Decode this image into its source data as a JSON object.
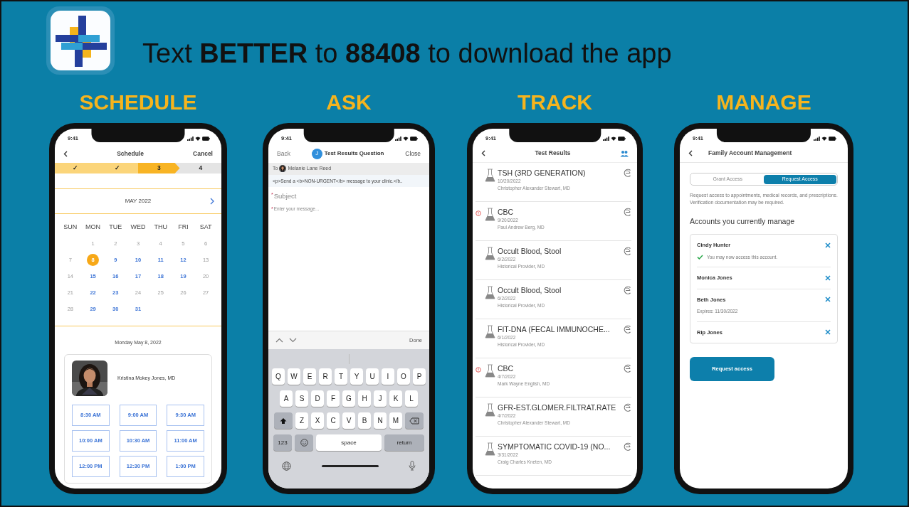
{
  "header": {
    "headline": "Text **BETTER** to **88408** to download the app"
  },
  "panels": [
    {
      "kind": "schedule",
      "heading": "SCHEDULE",
      "screen": {
        "status_time": "9:41",
        "title": "Schedule",
        "action": "Cancel",
        "steps": [
          {
            "label": "✓",
            "done": true,
            "current": false
          },
          {
            "label": "✓",
            "done": true,
            "current": false
          },
          {
            "label": "3",
            "done": false,
            "current": true
          },
          {
            "label": "4",
            "done": false,
            "current": false
          }
        ],
        "month": "MAY 2022",
        "weekdays": [
          "SUN",
          "MON",
          "TUE",
          "WED",
          "THU",
          "FRI",
          "SAT"
        ],
        "leading_blank_cell": true,
        "days": [
          {
            "label": "1",
            "available": false,
            "selected": false
          },
          {
            "label": "2",
            "available": false,
            "selected": false
          },
          {
            "label": "3",
            "available": false,
            "selected": false
          },
          {
            "label": "4",
            "available": false,
            "selected": false
          },
          {
            "label": "5",
            "available": false,
            "selected": false
          },
          {
            "label": "6",
            "available": false,
            "selected": false
          },
          {
            "label": "7",
            "available": false,
            "selected": false
          },
          {
            "label": "8",
            "available": true,
            "selected": true
          },
          {
            "label": "9",
            "available": true,
            "selected": false
          },
          {
            "label": "10",
            "available": true,
            "selected": false
          },
          {
            "label": "11",
            "available": true,
            "selected": false
          },
          {
            "label": "12",
            "available": true,
            "selected": false
          },
          {
            "label": "13",
            "available": false,
            "selected": false
          },
          {
            "label": "14",
            "available": false,
            "selected": false
          },
          {
            "label": "15",
            "available": true,
            "selected": false
          },
          {
            "label": "16",
            "available": true,
            "selected": false
          },
          {
            "label": "17",
            "available": true,
            "selected": false
          },
          {
            "label": "18",
            "available": true,
            "selected": false
          },
          {
            "label": "19",
            "available": true,
            "selected": false
          },
          {
            "label": "20",
            "available": false,
            "selected": false
          },
          {
            "label": "21",
            "available": false,
            "selected": false
          },
          {
            "label": "22",
            "available": true,
            "selected": false
          },
          {
            "label": "23",
            "available": true,
            "selected": false
          },
          {
            "label": "24",
            "available": false,
            "selected": false
          },
          {
            "label": "25",
            "available": false,
            "selected": false
          },
          {
            "label": "26",
            "available": false,
            "selected": false
          },
          {
            "label": "27",
            "available": false,
            "selected": false
          },
          {
            "label": "28",
            "available": false,
            "selected": false
          },
          {
            "label": "29",
            "available": true,
            "selected": false
          },
          {
            "label": "30",
            "available": true,
            "selected": false
          },
          {
            "label": "31",
            "available": true,
            "selected": false
          }
        ],
        "date": "Monday May 8, 2022",
        "provider": "Kristina Mokey Jones, MD",
        "times": [
          "8:30 AM",
          "9:00 AM",
          "9:30 AM",
          "10:00 AM",
          "10:30 AM",
          "11:00 AM",
          "12:00 PM",
          "12:30 PM",
          "1:00 PM"
        ]
      }
    },
    {
      "kind": "ask",
      "heading": "ASK",
      "screen": {
        "status_time": "9:41",
        "back": "Back",
        "avatar_initial": "J",
        "title": "Test Results Question",
        "action": "Close",
        "to_label": "To",
        "recipient": "Melanie Lane Reed",
        "notice": "<p>Send a <b>NON-URGENT</b> message to your clinic.</b..",
        "subject": {
          "placeholder": "Subject",
          "required_mark": "*"
        },
        "message": {
          "placeholder": "Enter your message...",
          "required_mark": "*"
        },
        "toolbar_action": "Done",
        "keyboard": {
          "rows": [
            [
              "Q",
              "W",
              "E",
              "R",
              "T",
              "Y",
              "U",
              "I",
              "O",
              "P"
            ],
            [
              "A",
              "S",
              "D",
              "F",
              "G",
              "H",
              "J",
              "K",
              "L"
            ],
            [
              "Z",
              "X",
              "C",
              "V",
              "B",
              "N",
              "M"
            ]
          ],
          "numbers_key": "123",
          "space_key": "space",
          "return_key": "return"
        }
      }
    },
    {
      "kind": "track",
      "heading": "TRACK",
      "screen": {
        "status_time": "9:41",
        "title": "Test Results",
        "results": [
          {
            "name": "TSH (3RD GENERATION)",
            "date": "10/20/2022",
            "provider": "Christopher Alexander Stewart, MD",
            "flagged": false
          },
          {
            "name": "CBC",
            "date": "9/20/2022",
            "provider": "Paul Andrew Berg, MD",
            "flagged": true
          },
          {
            "name": "Occult Blood, Stool",
            "date": "6/2/2022",
            "provider": "Historical Provider, MD",
            "flagged": false
          },
          {
            "name": "Occult Blood, Stool",
            "date": "6/2/2022",
            "provider": "Historical Provider, MD",
            "flagged": false
          },
          {
            "name": "FIT-DNA (FECAL IMMUNOCHE...",
            "date": "6/1/2022",
            "provider": "Historical Provider, MD",
            "flagged": false
          },
          {
            "name": "CBC",
            "date": "4/7/2022",
            "provider": "Mark Wayne English, MD",
            "flagged": true
          },
          {
            "name": "GFR-EST.GLOMER.FILTRAT.RATE",
            "date": "4/7/2022",
            "provider": "Christopher Alexander Stewart, MD",
            "flagged": false
          },
          {
            "name": "SYMPTOMATIC COVID-19 (NO...",
            "date": "3/31/2022",
            "provider": "Craig Charles Kneten, MD",
            "flagged": false
          }
        ]
      }
    },
    {
      "kind": "manage",
      "heading": "MANAGE",
      "screen": {
        "status_time": "9:41",
        "title": "Family Account Management",
        "tabs": [
          {
            "label": "Grant Access",
            "selected": false
          },
          {
            "label": "Request Access",
            "selected": true
          }
        ],
        "description": "Request access to appointments, medical records, and prescriptions. Verification documentation may be required.",
        "section_title": "Accounts you currently manage",
        "accounts": [
          {
            "name": "Cindy Hunter",
            "note": "You may now access this account.",
            "confirmed": true
          },
          {
            "name": "Monica Jones"
          },
          {
            "name": "Beth Jones",
            "note": "Expires: 11/30/2022",
            "confirmed": false
          },
          {
            "name": "Rip Jones"
          }
        ],
        "button": "Request access"
      }
    }
  ]
}
